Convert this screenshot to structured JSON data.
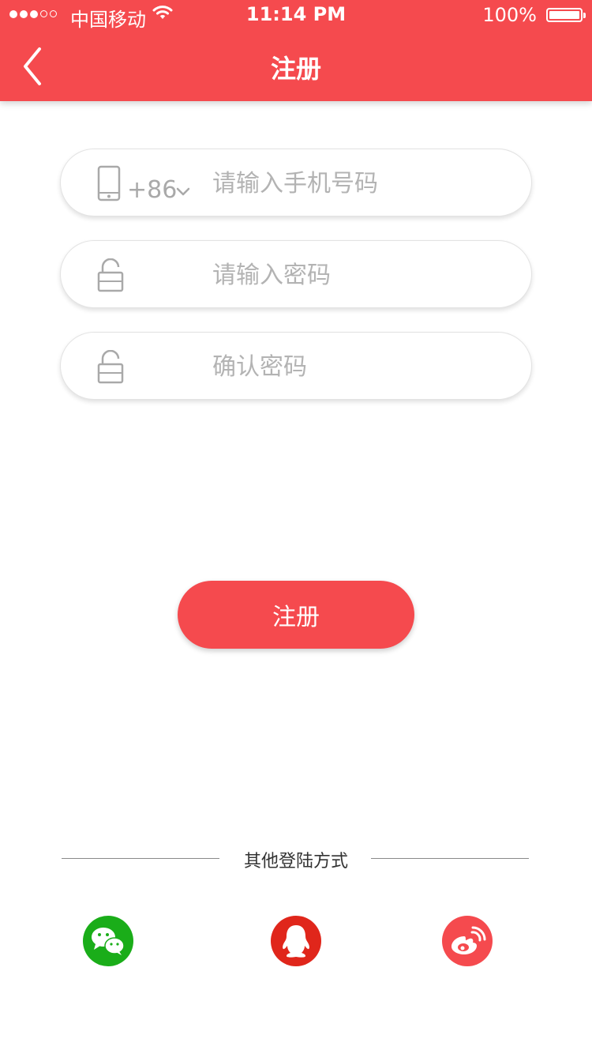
{
  "status_bar": {
    "carrier": "中国移动",
    "time": "11:14 PM",
    "battery": "100%"
  },
  "header": {
    "title": "注册",
    "back_icon": "chevron-left-icon"
  },
  "form": {
    "phone": {
      "country_code": "+86",
      "placeholder": "请输入手机号码",
      "value": ""
    },
    "password": {
      "placeholder": "请输入密码",
      "value": ""
    },
    "confirm_password": {
      "placeholder": "确认密码",
      "value": ""
    },
    "submit_label": "注册"
  },
  "other_login": {
    "label": "其他登陆方式",
    "providers": [
      {
        "icon": "wechat-icon",
        "color": "#1aad19"
      },
      {
        "icon": "qq-icon",
        "color": "#e0261b"
      },
      {
        "icon": "weibo-icon",
        "color": "#f54a4e"
      }
    ]
  },
  "colors": {
    "accent": "#f54a4e",
    "placeholder": "#b3b3b3",
    "icon_gray": "#a9a9a9"
  }
}
